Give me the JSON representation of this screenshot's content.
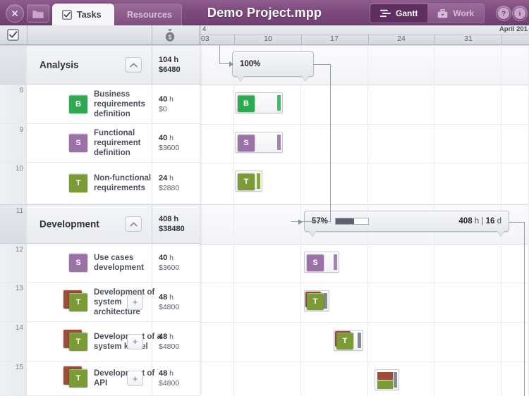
{
  "window": {
    "title": "Demo Project.mpp"
  },
  "toolbar": {
    "close_label": "✕",
    "folder_label": "folder-icon",
    "tabs": [
      {
        "label": "Tasks",
        "icon": "checkbox-icon",
        "active": true
      },
      {
        "label": "Resources",
        "icon": "person-icon",
        "active": false
      }
    ],
    "view_modes": [
      {
        "label": "Gantt",
        "icon": "gantt-icon",
        "active": true
      },
      {
        "label": "Work",
        "icon": "briefcase-icon",
        "active": false
      }
    ],
    "help_label": "?",
    "info_label": "i"
  },
  "columns": {
    "check_icon": "checkbox-icon",
    "cost_icon": "money-bag-icon"
  },
  "timeline": {
    "month_left": "4",
    "month_right": "April 201",
    "ticks": [
      "03",
      "10",
      "17",
      "24",
      "31"
    ]
  },
  "rows": [
    {
      "kind": "group",
      "num": "",
      "name": "Analysis",
      "hours": "104",
      "hours_unit": "h",
      "cost": "$6480",
      "collapse": "chevron-up-icon",
      "bar": {
        "percent": "100%"
      }
    },
    {
      "kind": "task",
      "num": "8",
      "name": "Business requirements definition",
      "hours": "40",
      "hours_unit": "h",
      "cost": "$0",
      "badge": "B",
      "badge_color": "#2eab51",
      "stripe_color": "#39c063"
    },
    {
      "kind": "task",
      "num": "9",
      "name": "Functional requirement definition",
      "hours": "40",
      "hours_unit": "h",
      "cost": "$3600",
      "badge": "S",
      "badge_color": "#9a72a8",
      "stripe_color": "#a77fb5"
    },
    {
      "kind": "task",
      "num": "10",
      "name": "Non-functional requirements",
      "hours": "24",
      "hours_unit": "h",
      "cost": "$2880",
      "badge": "T",
      "badge_color": "#7a9b36",
      "stripe_color": "#86a83e"
    },
    {
      "kind": "group",
      "num": "11",
      "name": "Development",
      "hours": "408",
      "hours_unit": "h",
      "cost": "$38480",
      "collapse": "chevron-up-icon",
      "bar": {
        "percent": "57%",
        "progress_value": 57,
        "total_hours": "408",
        "total_hours_unit": "h",
        "separator": "|",
        "duration": "16",
        "duration_unit": "d"
      }
    },
    {
      "kind": "task",
      "num": "12",
      "name": "Use cases development",
      "hours": "40",
      "hours_unit": "h",
      "cost": "$3600",
      "badge": "S",
      "badge_color": "#9a72a8",
      "stripe_color": "#a77fb5"
    },
    {
      "kind": "task",
      "num": "13",
      "name": "Development of system architecture",
      "hours": "48",
      "hours_unit": "h",
      "cost": "$4800",
      "badge": "T",
      "badge_color": "#7a9b36",
      "badge_back_color": "#9c4b3c",
      "stripe_color": "#878a93",
      "add_label": "+"
    },
    {
      "kind": "task",
      "num": "14",
      "name": "Development of a system kernel",
      "hours": "48",
      "hours_unit": "h",
      "cost": "$4800",
      "badge": "T",
      "badge_color": "#7a9b36",
      "badge_back_color": "#9c4b3c",
      "stripe_color": "#878a93",
      "add_label": "+"
    },
    {
      "kind": "task",
      "num": "15",
      "name": "Development of API",
      "hours": "48",
      "hours_unit": "h",
      "cost": "$4800",
      "badge": "T",
      "badge_color": "#7a9b36",
      "badge_back_color": "#9c4b3c",
      "stripe_color": "#878a93",
      "add_label": "+"
    }
  ],
  "colors": {
    "brand_purple": "#7d4b7d",
    "accent_dark": "#5f2f62",
    "green": "#2eab51",
    "olive": "#7a9b36",
    "violet": "#9a72a8",
    "brown": "#9c4b3c",
    "progress": "#5c6270"
  }
}
